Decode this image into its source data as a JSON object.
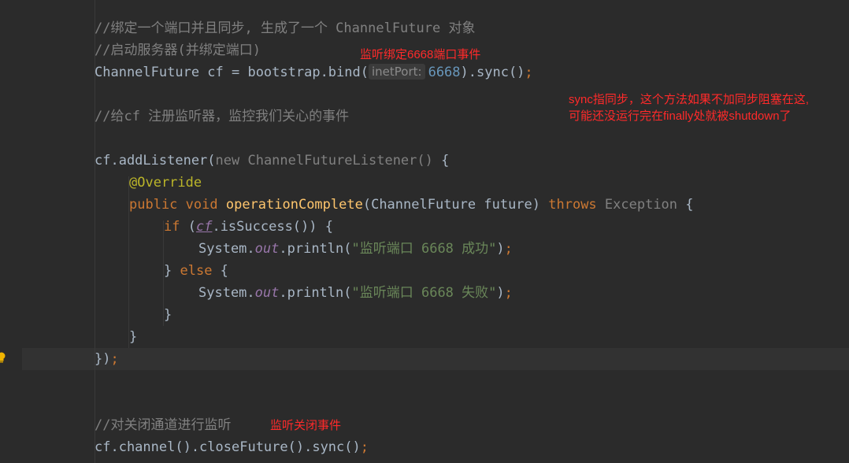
{
  "colors": {
    "background": "#2b2b2b",
    "current_line": "#323232",
    "comment": "#808080",
    "keyword": "#cc7832",
    "function": "#ffc66d",
    "string": "#6a8759",
    "annotation": "#bbb529",
    "number": "#6897bb",
    "static_field": "#9876aa",
    "annotation_note": "#ff2a2a"
  },
  "code": {
    "l1_comment": "//绑定一个端口并且同步, 生成了一个 ChannelFuture 对象",
    "l2_comment": "//启动服务器(并绑定端口)",
    "l3_a": "ChannelFuture cf = bootstrap.bind(",
    "l3_hint": "inetPort:",
    "l3_num": "6668",
    "l3_b": ").sync()",
    "l3_semi": ";",
    "l4_comment": "//给cf 注册监听器，监控我们关心的事件",
    "l5_a": "cf.addListener(",
    "l5_new": "new ChannelFutureListener()",
    "l5_b": " {",
    "l6_annotation": "@Override",
    "l7_public": "public",
    "l7_void": " void ",
    "l7_method": "operationComplete",
    "l7_params": "(ChannelFuture future) ",
    "l7_throws": "throws",
    "l7_exception": " Exception",
    "l7_brace": " {",
    "l8_if": "if",
    "l8_open": " (",
    "l8_cf": "cf",
    "l8_rest": ".isSuccess()) {",
    "l9_a": "System.",
    "l9_out": "out",
    "l9_b": ".println(",
    "l9_str": "\"监听端口 6668 成功\"",
    "l9_c": ")",
    "l9_semi": ";",
    "l10_brace": "} ",
    "l10_else": "else",
    "l10_open": " {",
    "l11_a": "System.",
    "l11_out": "out",
    "l11_b": ".println(",
    "l11_str": "\"监听端口 6668 失败\"",
    "l11_c": ")",
    "l11_semi": ";",
    "l12_close": "}",
    "l13_close": "}",
    "l14_close": "})",
    "l14_semi": ";",
    "l15_comment": "//对关闭通道进行监听",
    "l16_code": "cf.channel().closeFuture().sync()",
    "l16_semi": ";"
  },
  "annotations": {
    "bind_note": "监听绑定6668端口事件",
    "sync_note_1": "sync指同步，这个方法如果不加同步阻塞在这,",
    "sync_note_2": "可能还没运行完在finally处就被shutdown了",
    "close_note": "监听关闭事件"
  },
  "icons": {
    "gutter": "lightbulb-icon"
  }
}
